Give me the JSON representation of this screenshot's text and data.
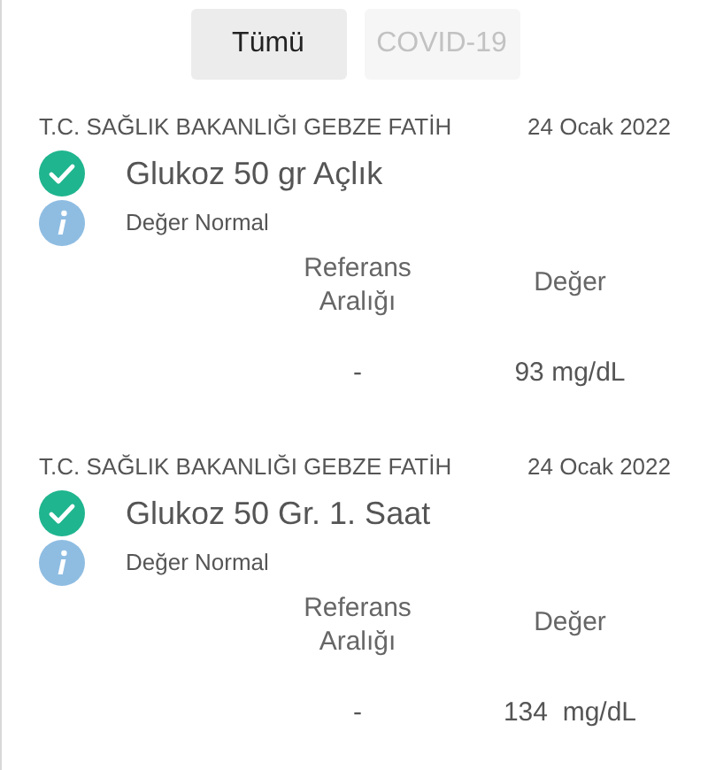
{
  "tabs": [
    {
      "label": "Tümü",
      "selected": true
    },
    {
      "label": "COVID-19",
      "selected": false
    }
  ],
  "results": [
    {
      "hospital": "T.C. SAĞLIK BAKANLIĞI GEBZE FATİH",
      "date": "24 Ocak 2022",
      "test": "Glukoz 50 gr Açlık",
      "normal": true,
      "note": "Değer Normal",
      "ref_header": "Referans Aralığı",
      "value_header": "Değer",
      "ref": "-",
      "value": "93 mg/dL"
    },
    {
      "hospital": "T.C. SAĞLIK BAKANLIĞI GEBZE FATİH",
      "date": "24 Ocak 2022",
      "test": "Glukoz 50 Gr. 1. Saat",
      "normal": true,
      "note": "Değer Normal",
      "ref_header": "Referans Aralığı",
      "value_header": "Değer",
      "ref": "-",
      "value": "134  mg/dL"
    }
  ]
}
